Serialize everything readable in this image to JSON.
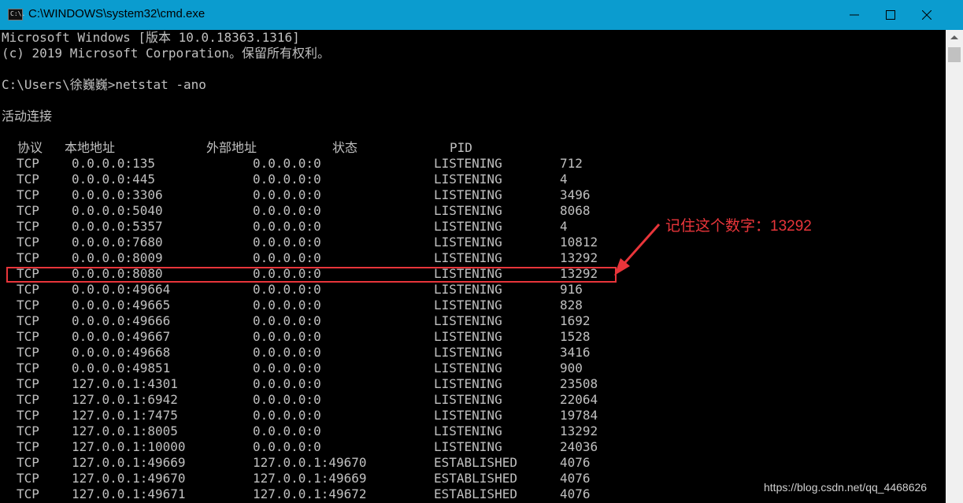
{
  "window": {
    "title": "C:\\WINDOWS\\system32\\cmd.exe",
    "icon_text": "C:\\."
  },
  "header_lines": [
    "Microsoft Windows [版本 10.0.18363.1316]",
    "(c) 2019 Microsoft Corporation。保留所有权利。",
    "",
    "C:\\Users\\徐巍巍>netstat -ano",
    "",
    "活动连接"
  ],
  "table": {
    "headers": [
      "协议",
      "本地地址",
      "外部地址",
      "状态",
      "PID"
    ],
    "rows": [
      {
        "proto": "TCP",
        "local": "0.0.0.0:135",
        "foreign": "0.0.0.0:0",
        "state": "LISTENING",
        "pid": "712"
      },
      {
        "proto": "TCP",
        "local": "0.0.0.0:445",
        "foreign": "0.0.0.0:0",
        "state": "LISTENING",
        "pid": "4"
      },
      {
        "proto": "TCP",
        "local": "0.0.0.0:3306",
        "foreign": "0.0.0.0:0",
        "state": "LISTENING",
        "pid": "3496"
      },
      {
        "proto": "TCP",
        "local": "0.0.0.0:5040",
        "foreign": "0.0.0.0:0",
        "state": "LISTENING",
        "pid": "8068"
      },
      {
        "proto": "TCP",
        "local": "0.0.0.0:5357",
        "foreign": "0.0.0.0:0",
        "state": "LISTENING",
        "pid": "4"
      },
      {
        "proto": "TCP",
        "local": "0.0.0.0:7680",
        "foreign": "0.0.0.0:0",
        "state": "LISTENING",
        "pid": "10812"
      },
      {
        "proto": "TCP",
        "local": "0.0.0.0:8009",
        "foreign": "0.0.0.0:0",
        "state": "LISTENING",
        "pid": "13292"
      },
      {
        "proto": "TCP",
        "local": "0.0.0.0:8080",
        "foreign": "0.0.0.0:0",
        "state": "LISTENING",
        "pid": "13292"
      },
      {
        "proto": "TCP",
        "local": "0.0.0.0:49664",
        "foreign": "0.0.0.0:0",
        "state": "LISTENING",
        "pid": "916"
      },
      {
        "proto": "TCP",
        "local": "0.0.0.0:49665",
        "foreign": "0.0.0.0:0",
        "state": "LISTENING",
        "pid": "828"
      },
      {
        "proto": "TCP",
        "local": "0.0.0.0:49666",
        "foreign": "0.0.0.0:0",
        "state": "LISTENING",
        "pid": "1692"
      },
      {
        "proto": "TCP",
        "local": "0.0.0.0:49667",
        "foreign": "0.0.0.0:0",
        "state": "LISTENING",
        "pid": "1528"
      },
      {
        "proto": "TCP",
        "local": "0.0.0.0:49668",
        "foreign": "0.0.0.0:0",
        "state": "LISTENING",
        "pid": "3416"
      },
      {
        "proto": "TCP",
        "local": "0.0.0.0:49851",
        "foreign": "0.0.0.0:0",
        "state": "LISTENING",
        "pid": "900"
      },
      {
        "proto": "TCP",
        "local": "127.0.0.1:4301",
        "foreign": "0.0.0.0:0",
        "state": "LISTENING",
        "pid": "23508"
      },
      {
        "proto": "TCP",
        "local": "127.0.0.1:6942",
        "foreign": "0.0.0.0:0",
        "state": "LISTENING",
        "pid": "22064"
      },
      {
        "proto": "TCP",
        "local": "127.0.0.1:7475",
        "foreign": "0.0.0.0:0",
        "state": "LISTENING",
        "pid": "19784"
      },
      {
        "proto": "TCP",
        "local": "127.0.0.1:8005",
        "foreign": "0.0.0.0:0",
        "state": "LISTENING",
        "pid": "13292"
      },
      {
        "proto": "TCP",
        "local": "127.0.0.1:10000",
        "foreign": "0.0.0.0:0",
        "state": "LISTENING",
        "pid": "24036"
      },
      {
        "proto": "TCP",
        "local": "127.0.0.1:49669",
        "foreign": "127.0.0.1:49670",
        "state": "ESTABLISHED",
        "pid": "4076"
      },
      {
        "proto": "TCP",
        "local": "127.0.0.1:49670",
        "foreign": "127.0.0.1:49669",
        "state": "ESTABLISHED",
        "pid": "4076"
      },
      {
        "proto": "TCP",
        "local": "127.0.0.1:49671",
        "foreign": "127.0.0.1:49672",
        "state": "ESTABLISHED",
        "pid": "4076"
      }
    ],
    "highlighted_row_index": 7
  },
  "annotation": {
    "text": "记住这个数字：13292",
    "color": "#e8353a"
  },
  "watermark": "https://blog.csdn.net/qq_4468626",
  "colors": {
    "titlebar": "#0b9ccf",
    "console_bg": "#000000",
    "console_text": "#c0c0c0",
    "highlight": "#e8353a"
  },
  "icons": {
    "app": "cmd-app-icon",
    "minimize": "minimize-icon",
    "maximize": "maximize-icon",
    "close": "close-icon",
    "scroll_up": "scroll-up-arrow-icon"
  }
}
